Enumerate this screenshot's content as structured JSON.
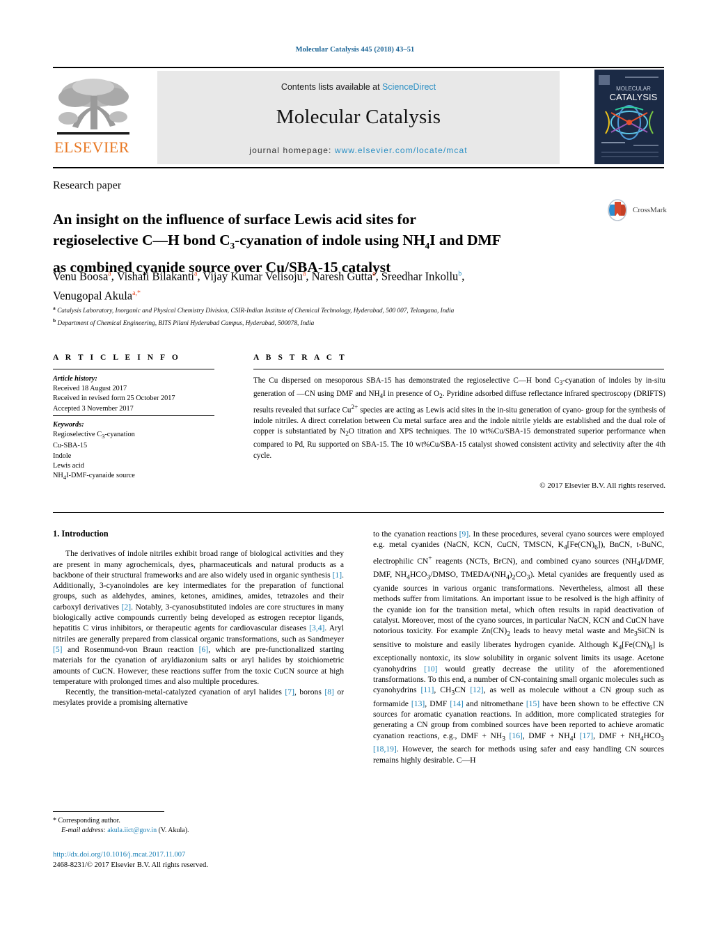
{
  "running_head": "Molecular Catalysis 445 (2018) 43–51",
  "masthead": {
    "contents_prefix": "Contents lists available at ",
    "sciencedirect": "ScienceDirect",
    "journal_title": "Molecular Catalysis",
    "homepage_prefix": "journal homepage: ",
    "homepage_url": "www.elsevier.com/locate/mcat",
    "publisher_wordmark": "ELSEVIER",
    "cover_line1": "MOLECULAR",
    "cover_line2": "CATALYSIS",
    "accent_link": "#2b8fc4",
    "accent_orange": "#e87722"
  },
  "article": {
    "type": "Research paper",
    "title_line1": "An insight on the influence of surface Lewis acid sites for",
    "title_line2_a": "regioselective C",
    "title_line2_dash": "—",
    "title_line2_b": "H bond C",
    "title_line2_sub": "3",
    "title_line2_c": "-cyanation of indole using NH",
    "title_line2_sub2": "4",
    "title_line2_d": "I and DMF",
    "title_line3": "as combined cyanide source over Cu/SBA-15 catalyst",
    "crossmark_label": "CrossMark"
  },
  "authors": {
    "list": [
      {
        "name": "Venu Boosa",
        "aff": "a"
      },
      {
        "name": "Vishali Bilakanti",
        "aff": "a"
      },
      {
        "name": "Vijay Kumar Velisoju",
        "aff": "a"
      },
      {
        "name": "Naresh Gutta",
        "aff": "a"
      },
      {
        "name": "Sreedhar Inkollu",
        "aff": "b"
      },
      {
        "name": "Venugopal Akula",
        "aff": "a,*"
      }
    ],
    "affiliations": [
      {
        "marker": "a",
        "text": "Catalysis Laboratory, Inorganic and Physical Chemistry Division, CSIR-Indian Institute of Chemical Technology, Hyderabad, 500 007, Telangana, India"
      },
      {
        "marker": "b",
        "text": "Department of Chemical Engineering, BITS Pilani Hyderabad Campus, Hyderabad, 500078, India"
      }
    ]
  },
  "info": {
    "heading": "A R T I C L E   I N F O",
    "history_label": "Article history:",
    "history": [
      "Received 18 August 2017",
      "Received in revised form 25 October 2017",
      "Accepted 3 November 2017"
    ],
    "keywords_label": "Keywords:",
    "keywords": [
      "Regioselective C3-cyanation",
      "Cu-SBA-15",
      "Indole",
      "Lewis acid",
      "NH4I-DMF-cyanaide source"
    ]
  },
  "abstract": {
    "heading": "A B S T R A C T",
    "text": "The Cu dispersed on mesoporous SBA-15 has demonstrated the regioselective C—H bond C3-cyanation of indoles by in-situ generation of —CN using DMF and NH4I in presence of O2. Pyridine adsorbed diffuse reflectance infrared spectroscopy (DRIFTS) results revealed that surface Cu2+ species are acting as Lewis acid sites in the in-situ generation of cyano- group for the synthesis of indole nitriles. A direct correlation between Cu metal surface area and the indole nitrile yields are established and the dual role of copper is substantiated by N2O titration and XPS techniques. The 10 wt%Cu/SBA-15 demonstrated superior performance when compared to Pd, Ru supported on SBA-15. The 10 wt%Cu/SBA-15 catalyst showed consistent activity and selectivity after the 4th cycle.",
    "copyright": "© 2017 Elsevier B.V. All rights reserved."
  },
  "body": {
    "section_number": "1.",
    "section_title": "Introduction",
    "left_paragraphs": [
      "The derivatives of indole nitriles exhibit broad range of biological activities and they are present in many agrochemicals, dyes, pharmaceuticals and natural products as a backbone of their structural frameworks and are also widely used in organic synthesis [1]. Additionally, 3-cyanoindoles are key intermediates for the preparation of functional groups, such as aldehydes, amines, ketones, amidines, amides, tetrazoles and their carboxyl derivatives [2]. Notably, 3-cyanosubstituted indoles are core structures in many biologically active compounds currently being developed as estrogen receptor ligands, hepatitis C virus inhibitors, or therapeutic agents for cardiovascular diseases [3,4]. Aryl nitriles are generally prepared from classical organic transformations, such as Sandmeyer [5] and Rosenmund-von Braun reaction [6], which are pre-functionalized starting materials for the cyanation of aryldiazonium salts or aryl halides by stoichiometric amounts of CuCN. However, these reactions suffer from the toxic CuCN source at high temperature with prolonged times and also multiple procedures.",
      "Recently, the transition-metal-catalyzed cyanation of aryl halides [7], borons [8] or mesylates provide a promising alternative"
    ],
    "right_paragraphs": [
      "to the cyanation reactions [9]. In these procedures, several cyano sources were employed e.g. metal cyanides (NaCN, KCN, CuCN, TMSCN, K4[Fe(CN)6]), BnCN, t-BuNC, electrophilic CN+ reagents (NCTs, BrCN), and combined cyano sources (NH4I/DMF, DMF, NH4HCO3/DMSO, TMEDA/(NH4)2CO3). Metal cyanides are frequently used as cyanide sources in various organic transformations. Nevertheless, almost all these methods suffer from limitations. An important issue to be resolved is the high affinity of the cyanide ion for the transition metal, which often results in rapid deactivation of catalyst. Moreover, most of the cyano sources, in particular NaCN, KCN and CuCN have notorious toxicity. For example Zn(CN)2 leads to heavy metal waste and Me3SiCN is sensitive to moisture and easily liberates hydrogen cyanide. Although K4[Fe(CN)6] is exceptionally nontoxic, its slow solubility in organic solvent limits its usage. Acetone cyanohydrins [10] would greatly decrease the utility of the aforementioned transformations. To this end, a number of CN-containing small organic molecules such as cyanohydrins [11], CH3CN [12], as well as molecule without a CN group such as formamide [13], DMF [14] and nitromethane [15] have been shown to be effective CN sources for aromatic cyanation reactions. In addition, more complicated strategies for generating a CN group from combined sources have been reported to achieve aromatic cyanation reactions, e.g., DMF + NH3 [16], DMF + NH4I [17], DMF + NH4HCO3 [18,19]. However, the search for methods using safer and easy handling CN sources remains highly desirable. C—H"
    ]
  },
  "footer": {
    "corresponding_marker": "*",
    "corresponding_label": "Corresponding author.",
    "email_label": "E-mail address:",
    "email": "akula.iict@gov.in",
    "email_suffix": "(V. Akula).",
    "doi": "http://dx.doi.org/10.1016/j.mcat.2017.11.007",
    "issn_line": "2468-8231/© 2017 Elsevier B.V. All rights reserved."
  }
}
